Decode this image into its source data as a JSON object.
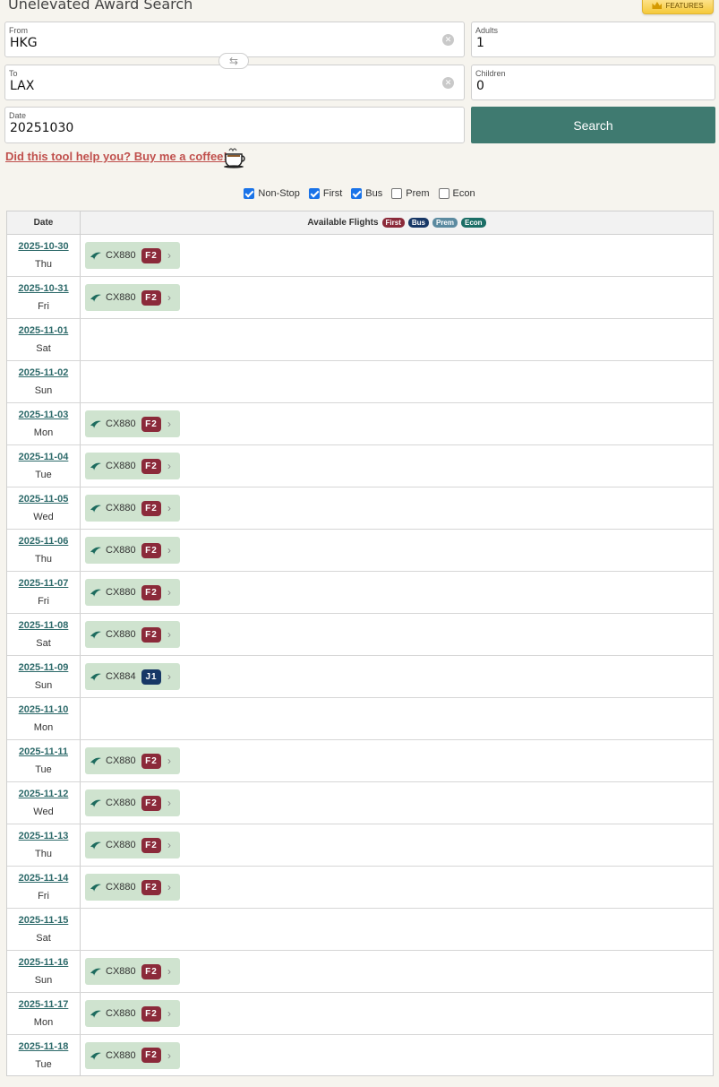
{
  "header": {
    "title": "Unelevated Award Search",
    "features_label": "FEATURES"
  },
  "form": {
    "from_label": "From",
    "from_value": "HKG",
    "to_label": "To",
    "to_value": "LAX",
    "date_label": "Date",
    "date_value": "20251030",
    "adults_label": "Adults",
    "adults_value": "1",
    "children_label": "Children",
    "children_value": "0",
    "search_label": "Search",
    "coffee_text": "Did this tool help you? Buy me a coffee!"
  },
  "filters": [
    {
      "label": "Non-Stop",
      "checked": true
    },
    {
      "label": "First",
      "checked": true
    },
    {
      "label": "Bus",
      "checked": true
    },
    {
      "label": "Prem",
      "checked": false
    },
    {
      "label": "Econ",
      "checked": false
    }
  ],
  "table": {
    "col_date": "Date",
    "col_flights": "Available Flights",
    "legend": {
      "first": "First",
      "bus": "Bus",
      "prem": "Prem",
      "econ": "Econ"
    }
  },
  "colors": {
    "first": "#8b2a3a",
    "bus": "#173766",
    "prem": "#5b8aa0",
    "econ": "#1b6e66",
    "search_button": "#3f7a70",
    "flight_pill": "#cfe3cf"
  },
  "rows": [
    {
      "date": "2025-10-30",
      "dow": "Thu",
      "flights": [
        {
          "number": "CX880",
          "fare": "F2",
          "cabin": "F"
        }
      ]
    },
    {
      "date": "2025-10-31",
      "dow": "Fri",
      "flights": [
        {
          "number": "CX880",
          "fare": "F2",
          "cabin": "F"
        }
      ]
    },
    {
      "date": "2025-11-01",
      "dow": "Sat",
      "flights": []
    },
    {
      "date": "2025-11-02",
      "dow": "Sun",
      "flights": []
    },
    {
      "date": "2025-11-03",
      "dow": "Mon",
      "flights": [
        {
          "number": "CX880",
          "fare": "F2",
          "cabin": "F"
        }
      ]
    },
    {
      "date": "2025-11-04",
      "dow": "Tue",
      "flights": [
        {
          "number": "CX880",
          "fare": "F2",
          "cabin": "F"
        }
      ]
    },
    {
      "date": "2025-11-05",
      "dow": "Wed",
      "flights": [
        {
          "number": "CX880",
          "fare": "F2",
          "cabin": "F"
        }
      ]
    },
    {
      "date": "2025-11-06",
      "dow": "Thu",
      "flights": [
        {
          "number": "CX880",
          "fare": "F2",
          "cabin": "F"
        }
      ]
    },
    {
      "date": "2025-11-07",
      "dow": "Fri",
      "flights": [
        {
          "number": "CX880",
          "fare": "F2",
          "cabin": "F"
        }
      ]
    },
    {
      "date": "2025-11-08",
      "dow": "Sat",
      "flights": [
        {
          "number": "CX880",
          "fare": "F2",
          "cabin": "F"
        }
      ]
    },
    {
      "date": "2025-11-09",
      "dow": "Sun",
      "flights": [
        {
          "number": "CX884",
          "fare": "J1",
          "cabin": "J"
        }
      ]
    },
    {
      "date": "2025-11-10",
      "dow": "Mon",
      "flights": []
    },
    {
      "date": "2025-11-11",
      "dow": "Tue",
      "flights": [
        {
          "number": "CX880",
          "fare": "F2",
          "cabin": "F"
        }
      ]
    },
    {
      "date": "2025-11-12",
      "dow": "Wed",
      "flights": [
        {
          "number": "CX880",
          "fare": "F2",
          "cabin": "F"
        }
      ]
    },
    {
      "date": "2025-11-13",
      "dow": "Thu",
      "flights": [
        {
          "number": "CX880",
          "fare": "F2",
          "cabin": "F"
        }
      ]
    },
    {
      "date": "2025-11-14",
      "dow": "Fri",
      "flights": [
        {
          "number": "CX880",
          "fare": "F2",
          "cabin": "F"
        }
      ]
    },
    {
      "date": "2025-11-15",
      "dow": "Sat",
      "flights": []
    },
    {
      "date": "2025-11-16",
      "dow": "Sun",
      "flights": [
        {
          "number": "CX880",
          "fare": "F2",
          "cabin": "F"
        }
      ]
    },
    {
      "date": "2025-11-17",
      "dow": "Mon",
      "flights": [
        {
          "number": "CX880",
          "fare": "F2",
          "cabin": "F"
        }
      ]
    },
    {
      "date": "2025-11-18",
      "dow": "Tue",
      "flights": [
        {
          "number": "CX880",
          "fare": "F2",
          "cabin": "F"
        }
      ]
    }
  ]
}
